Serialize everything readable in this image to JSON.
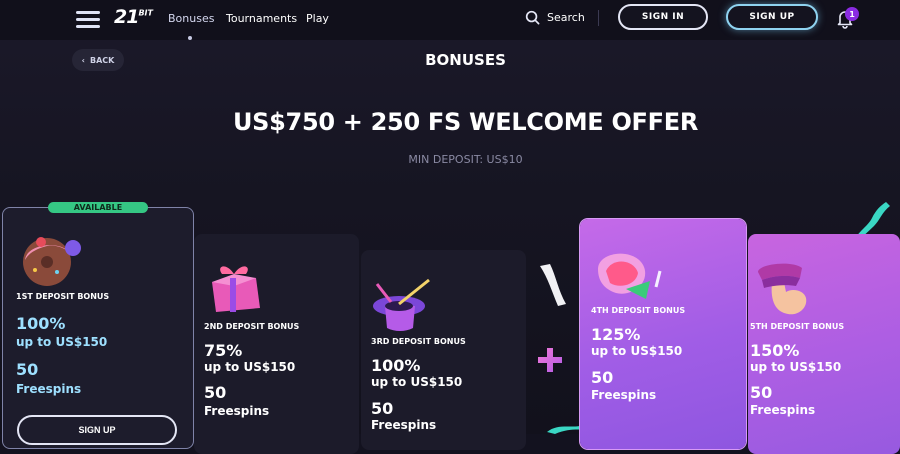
{
  "header": {
    "logo": "21",
    "logo_suffix": "BIT",
    "nav": [
      "Bonuses",
      "Tournaments",
      "Play"
    ],
    "search_label": "Search",
    "signin_label": "SIGN IN",
    "signup_label": "SIGN UP",
    "notification_count": "1"
  },
  "page": {
    "back_label": "BACK",
    "title": "BONUSES",
    "offer": "US$750 + 250 FS WELCOME OFFER",
    "min_deposit": "MIN DEPOSIT: US$10"
  },
  "cards": [
    {
      "badge": "AVAILABLE",
      "title": "1ST DEPOSIT BONUS",
      "percent": "100%",
      "up_to": "up to US$150",
      "fs_count": "50",
      "fs_label": "Freespins",
      "button": "SIGN UP",
      "icon": "donut-icon"
    },
    {
      "title": "2ND DEPOSIT BONUS",
      "percent": "75%",
      "up_to": "up to US$150",
      "fs_count": "50",
      "fs_label": "Freespins",
      "icon": "gift-icon"
    },
    {
      "title": "3RD DEPOSIT BONUS",
      "percent": "100%",
      "up_to": "up to US$150",
      "fs_count": "50",
      "fs_label": "Freespins",
      "icon": "magic-hat-icon"
    },
    {
      "title": "4TH DEPOSIT BONUS",
      "percent": "125%",
      "up_to": "up to US$150",
      "fs_count": "50",
      "fs_label": "Freespins",
      "icon": "watermelon-icon"
    },
    {
      "title": "5TH DEPOSIT BONUS",
      "percent": "150%",
      "up_to": "up to US$150",
      "fs_count": "50",
      "fs_label": "Freespins",
      "icon": "hand-icon"
    }
  ],
  "colors": {
    "background": "#13121f",
    "card_dark": "#1c1b2a",
    "accent_cyan": "#9ee0ff",
    "badge_green": "#35c784",
    "card_purple": "#a15de6"
  }
}
